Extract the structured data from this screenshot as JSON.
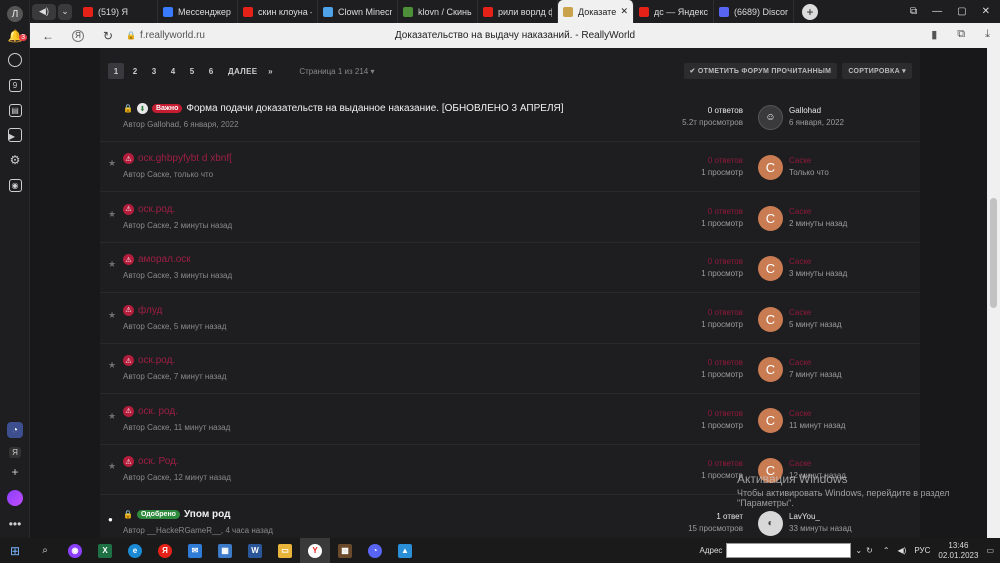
{
  "sidebar": {
    "profile_letter": "Л",
    "notifications_count": "3",
    "badge_9": "9",
    "discord_letter": "Я"
  },
  "tabs": [
    {
      "label": "(519) Я",
      "color": "#e62117",
      "active": false
    },
    {
      "label": "Мессенджер",
      "color": "#3a7bfd",
      "active": false
    },
    {
      "label": "скин клоуна –",
      "color": "#e62117",
      "active": false
    },
    {
      "label": "Clown Minecr",
      "color": "#4fa3e8",
      "active": false
    },
    {
      "label": "klovn / Скины",
      "color": "#4e8f3a",
      "active": false
    },
    {
      "label": "рили ворлд ф",
      "color": "#e62117",
      "active": false
    },
    {
      "label": "Доказатель",
      "color": "#c9a24a",
      "active": true
    },
    {
      "label": "дс — Яндекс",
      "color": "#e62117",
      "active": false
    },
    {
      "label": "(6689) Discord",
      "color": "#5865f2",
      "active": false
    }
  ],
  "address": {
    "url": "f.reallyworld.ru",
    "page_title": "Доказательство на выдачу наказаний. - ReallyWorld"
  },
  "pager": {
    "pages": [
      "1",
      "2",
      "3",
      "4",
      "5",
      "6"
    ],
    "next_label": "ДАЛЕЕ",
    "last_label": "»",
    "info": "Страница 1 из 214 ▾"
  },
  "tools": {
    "mark_read": "✔ ОТМЕТИТЬ ФОРУМ ПРОЧИТАННЫМ",
    "sort": "СОРТИРОВКА ▾"
  },
  "pinned": {
    "badge": "Важно",
    "title": "Форма подачи доказательств на выданное наказание. [ОБНОВЛЕНО 3 АПРЕЛЯ]",
    "author": "Автор Gallohad, 6 января, 2022",
    "replies": "0 ответов",
    "views": "5.2т просмотров",
    "last_user": "Gallohad",
    "last_time": "6 января, 2022"
  },
  "topics": [
    {
      "title": "оск.ghbpyfybt d xbnf[",
      "author": "Автор Саске, только что",
      "replies": "0 ответов",
      "views": "1 просмотр",
      "last_user": "Саске",
      "last_time": "Только что",
      "avatar": "С"
    },
    {
      "title": "оск.род.",
      "author": "Автор Саске, 2 минуты назад",
      "replies": "0 ответов",
      "views": "1 просмотр",
      "last_user": "Саске",
      "last_time": "2 минуты назад",
      "avatar": "С"
    },
    {
      "title": "аморал.оск",
      "author": "Автор Саске, 3 минуты назад",
      "replies": "0 ответов",
      "views": "1 просмотр",
      "last_user": "Саске",
      "last_time": "3 минуты назад",
      "avatar": "С"
    },
    {
      "title": "флуд",
      "author": "Автор Саске, 5 минут назад",
      "replies": "0 ответов",
      "views": "1 просмотр",
      "last_user": "Саске",
      "last_time": "5 минут назад",
      "avatar": "С"
    },
    {
      "title": "оск.род.",
      "author": "Автор Саске, 7 минут назад",
      "replies": "0 ответов",
      "views": "1 просмотр",
      "last_user": "Саске",
      "last_time": "7 минут назад",
      "avatar": "С"
    },
    {
      "title": "оск. род.",
      "author": "Автор Саске, 11 минут назад",
      "replies": "0 ответов",
      "views": "1 просмотр",
      "last_user": "Саске",
      "last_time": "11 минут назад",
      "avatar": "С"
    },
    {
      "title": "оск. Род.",
      "author": "Автор Саске, 12 минут назад",
      "replies": "0 ответов",
      "views": "1 просмотр",
      "last_user": "Саске",
      "last_time": "12 минут назад",
      "avatar": "С"
    }
  ],
  "approved": {
    "badge": "Одобрено",
    "title": "Упом род",
    "author": "Автор __HackeRGameR__, 4 часа назад",
    "replies": "1 ответ",
    "views": "15 просмотров",
    "last_user": "LavYou_",
    "last_time": "33 минуты назад"
  },
  "watermark": {
    "title": "Активация Windows",
    "line1": "Чтобы активировать Windows, перейдите в раздел",
    "line2": "\"Параметры\"."
  },
  "taskbar": {
    "address_label": "Адрес",
    "lang": "РУС",
    "time": "13:46",
    "date": "02.01.2023"
  }
}
